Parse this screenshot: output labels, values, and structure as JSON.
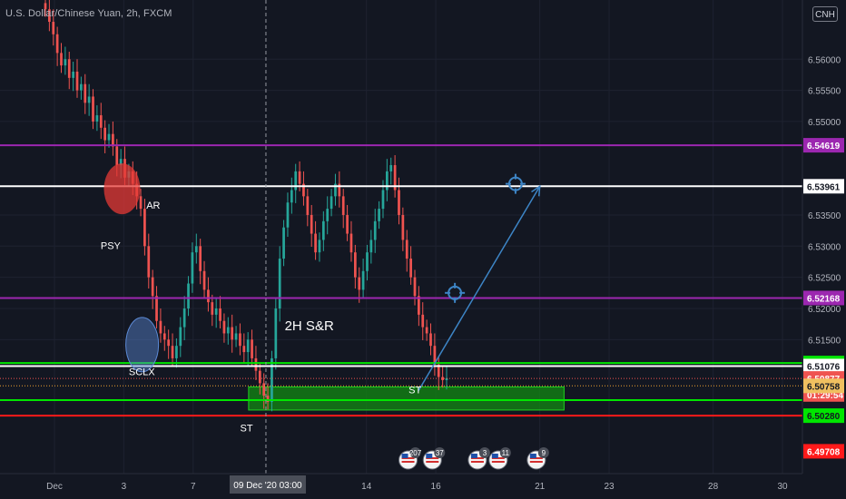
{
  "header": {
    "symbol": "U.S. Dollar/Chinese Yuan, 2h, FXCM",
    "currency": "CNH"
  },
  "colors": {
    "background": "#131722",
    "up": "#26a69a",
    "down": "#ef5350",
    "purple": "#9c27b0",
    "white": "#ffffff",
    "green": "#00e600",
    "red": "#ff1a1a",
    "orange": "#f0a030",
    "zone": "#138a13",
    "arrow": "#3d85c6"
  },
  "chart_data": {
    "type": "candlestick",
    "yaxis": {
      "min": 6.4935,
      "max": 6.5695,
      "ticks": [
        "6.56000",
        "6.55500",
        "6.55000",
        "6.53500",
        "6.53000",
        "6.52500",
        "6.52000",
        "6.51500"
      ]
    },
    "xaxis": {
      "ticks": [
        {
          "label": "Dec",
          "pos": 0.0
        },
        {
          "label": "3",
          "pos": 2.0
        },
        {
          "label": "7",
          "pos": 4.0
        },
        {
          "label": "14",
          "pos": 9.0
        },
        {
          "label": "16",
          "pos": 11.0
        },
        {
          "label": "21",
          "pos": 14.0
        },
        {
          "label": "23",
          "pos": 16.0
        },
        {
          "label": "28",
          "pos": 19.0
        },
        {
          "label": "30",
          "pos": 21.0
        }
      ],
      "crosshair_label": "09 Dec '20   03:00",
      "crosshair_pos": 6.1
    },
    "candles_close_path": [
      6.568,
      6.566,
      6.564,
      6.561,
      6.559,
      6.56,
      6.557,
      6.558,
      6.555,
      6.556,
      6.553,
      6.554,
      6.55,
      6.551,
      6.549,
      6.547,
      6.548,
      6.546,
      6.543,
      6.544,
      6.541,
      6.542,
      6.54,
      6.538,
      6.536,
      6.53,
      6.525,
      6.522,
      6.518,
      6.516,
      6.515,
      6.514,
      6.512,
      6.514,
      6.517,
      6.52,
      6.524,
      6.529,
      6.53,
      6.526,
      6.523,
      6.521,
      6.519,
      6.52,
      6.518,
      6.516,
      6.517,
      6.515,
      6.516,
      6.514,
      6.513,
      6.515,
      6.512,
      6.51,
      6.508,
      6.506,
      6.505,
      6.512,
      6.52,
      6.528,
      6.533,
      6.537,
      6.539,
      6.542,
      6.54,
      6.538,
      6.535,
      6.532,
      6.529,
      6.531,
      6.534,
      6.536,
      6.538,
      6.54,
      6.538,
      6.535,
      6.532,
      6.529,
      6.525,
      6.523,
      6.526,
      6.529,
      6.531,
      6.534,
      6.536,
      6.539,
      6.542,
      6.543,
      6.539,
      6.535,
      6.531,
      6.528,
      6.525,
      6.522,
      6.519,
      6.517,
      6.516,
      6.514,
      6.511,
      6.509,
      6.5085,
      6.5088
    ],
    "levels": [
      {
        "name": "resistance-top",
        "value": 6.54619,
        "color": "purple",
        "label": "6.54619",
        "label_bg": "#9c27b0",
        "label_fg": "#ffffff"
      },
      {
        "name": "resistance-white",
        "value": 6.53961,
        "color": "white",
        "label": "6.53961",
        "label_bg": "#ffffff",
        "label_fg": "#131722"
      },
      {
        "name": "mid-purple",
        "value": 6.52168,
        "color": "purple",
        "label": "6.52168",
        "label_bg": "#9c27b0",
        "label_fg": "#ffffff"
      },
      {
        "name": "support-green",
        "value": 6.51125,
        "color": "green",
        "label": "6.51125",
        "label_bg": "#00e600",
        "label_fg": "#131722"
      },
      {
        "name": "support-white",
        "value": 6.51076,
        "color": "white",
        "label": "6.51076",
        "label_bg": "#ffffff",
        "label_fg": "#131722"
      },
      {
        "name": "support-green-low",
        "value": 6.5053,
        "color": "green",
        "label": "",
        "label_bg": "",
        "label_fg": ""
      },
      {
        "name": "bottom-red",
        "value": 6.5028,
        "color": "red",
        "label": "",
        "label_bg": "",
        "label_fg": ""
      }
    ],
    "price_badges": [
      {
        "name": "last-price",
        "value": 6.50877,
        "label": "6.50877",
        "bg": "#ef5350",
        "fg": "#ffffff"
      },
      {
        "name": "countdown",
        "value": 6.5062,
        "label": "01:29:54",
        "bg": "#ef5350",
        "fg": "#ffffff"
      },
      {
        "name": "orange-level",
        "value": 6.50758,
        "label": "6.50758",
        "bg": "#f0c060",
        "fg": "#131722"
      },
      {
        "name": "green-bottom",
        "value": 6.5028,
        "label": "6.50280",
        "bg": "#00e600",
        "fg": "#131722"
      },
      {
        "name": "red-bottom",
        "value": 6.49708,
        "label": "6.49708",
        "bg": "#ff1a1a",
        "fg": "#ffffff"
      }
    ],
    "annotations": [
      {
        "text": "PSY",
        "x": 1.62,
        "y": 6.5295
      },
      {
        "text": "AR",
        "x": 2.85,
        "y": 6.536
      },
      {
        "text": "SCLX",
        "x": 2.52,
        "y": 6.5093
      },
      {
        "text": "ST",
        "x": 5.54,
        "y": 6.5003
      },
      {
        "text": "ST",
        "x": 10.4,
        "y": 6.5064
      },
      {
        "text": "2H S&R",
        "x": 7.35,
        "y": 6.5165
      }
    ],
    "events": [
      {
        "label": "207",
        "x": 10.2
      },
      {
        "label": "37",
        "x": 10.9
      },
      {
        "label": "3",
        "x": 12.2
      },
      {
        "label": "11",
        "x": 12.8
      },
      {
        "label": "9",
        "x": 13.9
      }
    ]
  }
}
